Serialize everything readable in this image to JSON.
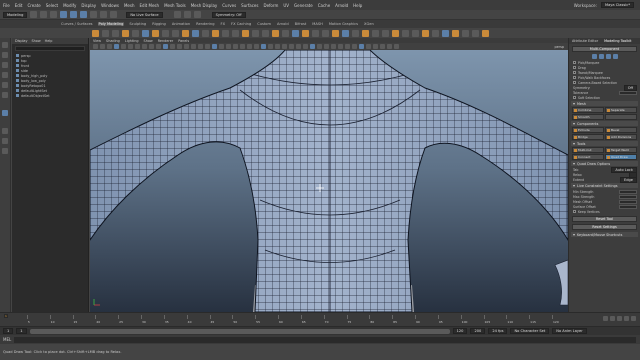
{
  "menubar": {
    "items": [
      "File",
      "Edit",
      "Create",
      "Select",
      "Modify",
      "Display",
      "Windows",
      "Mesh",
      "Edit Mesh",
      "Mesh Tools",
      "Mesh Display",
      "Curves",
      "Surfaces",
      "Deform",
      "UV",
      "Generate",
      "Cache",
      "Arnold",
      "Help"
    ],
    "workspace_label": "Workspace:",
    "workspace_value": "Maya Classic*"
  },
  "status": {
    "mode_value": "Modeling",
    "live_label": "No Live Surface",
    "symmetry_value": "Symmetry: Off"
  },
  "shelf_tabs": {
    "items": [
      "Curves / Surfaces",
      "Poly Modeling",
      "Sculpting",
      "Rigging",
      "Animation",
      "Rendering",
      "FX",
      "FX Caching",
      "Custom",
      "Arnold",
      "Bifrost",
      "MASH",
      "Motion Graphics",
      "XGen"
    ],
    "active_index": 1
  },
  "outliner": {
    "menu": [
      "Display",
      "Show",
      "Help"
    ],
    "rows": [
      "persp",
      "top",
      "front",
      "side",
      "body_high_poly",
      "body_low_poly",
      "bodyRetopo01",
      "defaultLightSet",
      "defaultObjectSet"
    ]
  },
  "viewport": {
    "menu": [
      "View",
      "Shading",
      "Lighting",
      "Show",
      "Renderer",
      "Panels"
    ],
    "camera_label": "persp"
  },
  "right_panel": {
    "tabs": [
      "Attribute Editor",
      "Modeling Toolkit"
    ],
    "top_button": "Multi-Component",
    "pick_label": "Pick/Marquee",
    "drag_label": "Drag",
    "tweak_label": "Tweak/Marquee",
    "pick_walk_label": "Pick/Walk Backfaces",
    "constraint_label": "Camera-Based Selection",
    "symmetry_label": "Symmetry:",
    "symmetry_value": "Off",
    "tolerance_label": "Tolerance",
    "soft_select_label": "Soft Selection",
    "mesh_section": "Mesh",
    "mesh_tools": [
      "Combine",
      "Separate",
      "Smooth",
      ""
    ],
    "components_section": "Components",
    "comp_tools": [
      "Extrude",
      "Bevel",
      "Bridge",
      "Add Divisions"
    ],
    "tools_section": "Tools",
    "tool_buttons": [
      "Multi-Cut",
      "Target Weld",
      "Connect",
      "Quad Draw"
    ],
    "quad_draw_section": "Quad Draw Options",
    "quad_rows": [
      {
        "label": "Tab",
        "value": "Auto Lock"
      },
      {
        "label": "Relax",
        "value": ""
      },
      {
        "label": "Extend",
        "value": "Edge"
      }
    ],
    "constraint_section": "Live Constraint Settings",
    "slider_rows": [
      "Min Strength",
      "Max Strength",
      "Mesh Offset",
      "Surface Offset"
    ],
    "keep_label": "Keep Vertices",
    "reset_button": "Reset Tool",
    "settings_button": "Reset Settings",
    "shortcut_section": "Keyboard/Mouse Shortcuts"
  },
  "timeslider": {
    "ticks": [
      "5",
      "10",
      "15",
      "20",
      "25",
      "30",
      "35",
      "40",
      "45",
      "50",
      "55",
      "60",
      "65",
      "70",
      "75",
      "80",
      "85",
      "90",
      "95",
      "100",
      "105",
      "110",
      "115",
      "120"
    ],
    "current_frame": "1"
  },
  "range": {
    "start": "1",
    "inner_start": "1",
    "inner_end": "120",
    "end": "200",
    "char_set": "No Character Set",
    "anim_layer": "No Anim Layer",
    "fps": "24 fps"
  },
  "cmdline": {
    "lang": "MEL"
  },
  "helpline": {
    "text": "Quad Draw Tool: Click to place dot. Ctrl+Shift+LMB drag to Relax."
  },
  "colors": {
    "accent": "#4f7fa8",
    "orange_icon": "#c98a3a",
    "mesh_wire": "#1a2030"
  }
}
